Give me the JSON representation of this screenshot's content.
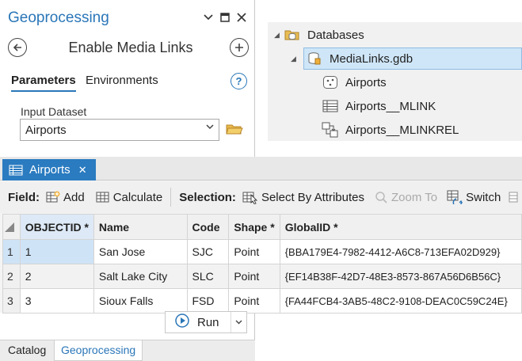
{
  "geoprocessing": {
    "title": "Geoprocessing",
    "tool_title": "Enable Media Links",
    "tabs": {
      "parameters": "Parameters",
      "environments": "Environments"
    },
    "input_label": "Input Dataset",
    "input_value": "Airports"
  },
  "catalog_tree": {
    "databases_label": "Databases",
    "gdb_label": "MediaLinks.gdb",
    "items": [
      "Airports",
      "Airports__MLINK",
      "Airports__MLINKREL"
    ]
  },
  "table_view": {
    "tab_label": "Airports",
    "toolbar": {
      "field_label": "Field:",
      "add": "Add",
      "calculate": "Calculate",
      "selection_label": "Selection:",
      "select_by_attributes": "Select By Attributes",
      "zoom_to": "Zoom To",
      "switch": "Switch"
    },
    "columns": [
      "OBJECTID *",
      "Name",
      "Code",
      "Shape *",
      "GlobalID *"
    ],
    "rows": [
      {
        "num": "1",
        "objectid": "1",
        "name": "San Jose",
        "code": "SJC",
        "shape": "Point",
        "globalid": "{BBA179E4-7982-4412-A6C8-713EFA02D929}"
      },
      {
        "num": "2",
        "objectid": "2",
        "name": "Salt Lake City",
        "code": "SLC",
        "shape": "Point",
        "globalid": "{EF14B38F-42D7-48E3-8573-867A56D6B56C}"
      },
      {
        "num": "3",
        "objectid": "3",
        "name": "Sioux Falls",
        "code": "FSD",
        "shape": "Point",
        "globalid": "{FA44FCB4-3AB5-48C2-9108-DEAC0C59C24E}"
      }
    ]
  },
  "run_label": "Run",
  "bottom_tabs": {
    "catalog": "Catalog",
    "geoprocessing": "Geoprocessing"
  },
  "colors": {
    "accent": "#2a76b8",
    "tab_active": "#2a7bc0",
    "selection": "#cfe6f8"
  }
}
